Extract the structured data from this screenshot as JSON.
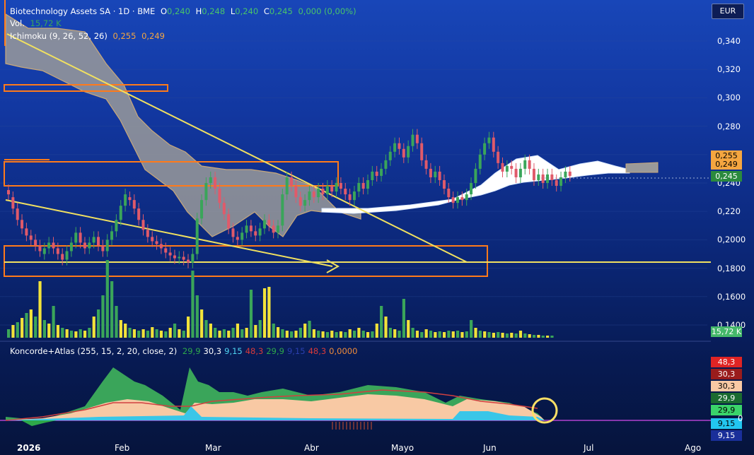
{
  "header": {
    "symbol": "Biotechnology Assets SA · 1D · BME",
    "o_label": "O",
    "o_value": "0,240",
    "h_label": "H",
    "h_value": "0,248",
    "l_label": "L",
    "l_value": "0,240",
    "c_label": "C",
    "c_value": "0,245",
    "change": "0,000 (0,00%)",
    "vol_label": "Vol.",
    "vol_value": "15,72 K",
    "ichimoku_label": "Ichimoku (9, 26, 52, 26)",
    "ichimoku_v1": "0,255",
    "ichimoku_v2": "0,249",
    "koncorde_label": "Koncorde+Atlas (255, 15, 2, 20, close, 2)",
    "koncorde_values": [
      {
        "v": "29,9",
        "color": "#2ea84a"
      },
      {
        "v": "30,3",
        "color": "#ffffff"
      },
      {
        "v": "9,15",
        "color": "#4fd3f0"
      },
      {
        "v": "48,3",
        "color": "#d83a3a"
      },
      {
        "v": "29,9",
        "color": "#2ea84a"
      },
      {
        "v": "9,15",
        "color": "#2a3fae"
      },
      {
        "v": "48,3",
        "color": "#d83a3a"
      },
      {
        "v": "0,0000",
        "color": "#f08c3a"
      }
    ]
  },
  "currency": "EUR",
  "y_axis": [
    "0,340",
    "0,320",
    "0,300",
    "0,280",
    "0,260",
    "0,240",
    "0,220",
    "0,2000",
    "0,1800",
    "0,1600",
    "0,1400"
  ],
  "price_badges": [
    {
      "label": "0,255",
      "bg": "#f5a640"
    },
    {
      "label": "0,249",
      "bg": "#f5a640"
    },
    {
      "label": "0,245",
      "bg": "#2b8a3e",
      "fg": "#ffffff"
    },
    {
      "label": "15,72 K",
      "bg": "#45b86a",
      "fg": "#ffffff"
    }
  ],
  "osc_badges": [
    {
      "label": "48,3",
      "bg": "#e02424",
      "fg": "#ffffff"
    },
    {
      "label": "30,3",
      "bg": "#9a1c1c",
      "fg": "#ffffff"
    },
    {
      "label": "30,3",
      "bg": "#f8c9a4",
      "fg": "#000000"
    },
    {
      "label": "29,9",
      "bg": "#1b6b30",
      "fg": "#ffffff"
    },
    {
      "label": "29,9",
      "bg": "#3ad36a",
      "fg": "#000000"
    },
    {
      "label": "9,15",
      "bg": "#22c6f0",
      "fg": "#000000"
    },
    {
      "label": "9,15",
      "bg": "#1a2f9a",
      "fg": "#ffffff"
    }
  ],
  "osc_zero": "0",
  "x_axis": [
    "2026",
    "Feb",
    "Mar",
    "Abr",
    "Mayo",
    "Jun",
    "Jul",
    "Ago"
  ],
  "colors": {
    "up": "#3aa55a",
    "down": "#e05a6a",
    "cloud": "#9a9a9a",
    "cloud_white": "#ffffff",
    "orange": "#ff7a1a",
    "yellow": "#f0e060",
    "vol_up": "#3aa55a",
    "vol_yellow": "#f2e23a"
  },
  "chart_data": {
    "type": "candlestick",
    "price_scale": [
      0.14,
      0.35
    ],
    "candles": [
      [
        0.235,
        0.232
      ],
      [
        0.23,
        0.222
      ],
      [
        0.222,
        0.214
      ],
      [
        0.214,
        0.208
      ],
      [
        0.208,
        0.203
      ],
      [
        0.203,
        0.2
      ],
      [
        0.2,
        0.196
      ],
      [
        0.196,
        0.192
      ],
      [
        0.19,
        0.194
      ],
      [
        0.194,
        0.198
      ],
      [
        0.198,
        0.194
      ],
      [
        0.194,
        0.19
      ],
      [
        0.19,
        0.186
      ],
      [
        0.186,
        0.192
      ],
      [
        0.192,
        0.198
      ],
      [
        0.198,
        0.205
      ],
      [
        0.205,
        0.198
      ],
      [
        0.198,
        0.194
      ],
      [
        0.194,
        0.198
      ],
      [
        0.198,
        0.202
      ],
      [
        0.202,
        0.196
      ],
      [
        0.196,
        0.192
      ],
      [
        0.192,
        0.2
      ],
      [
        0.2,
        0.206
      ],
      [
        0.206,
        0.214
      ],
      [
        0.214,
        0.224
      ],
      [
        0.224,
        0.232
      ],
      [
        0.23,
        0.228
      ],
      [
        0.228,
        0.222
      ],
      [
        0.222,
        0.214
      ],
      [
        0.214,
        0.207
      ],
      [
        0.207,
        0.202
      ],
      [
        0.202,
        0.199
      ],
      [
        0.199,
        0.197
      ],
      [
        0.197,
        0.194
      ],
      [
        0.194,
        0.191
      ],
      [
        0.191,
        0.189
      ],
      [
        0.189,
        0.187
      ],
      [
        0.187,
        0.188
      ],
      [
        0.188,
        0.186
      ],
      [
        0.186,
        0.184
      ],
      [
        0.184,
        0.19
      ],
      [
        0.19,
        0.215
      ],
      [
        0.215,
        0.228
      ],
      [
        0.228,
        0.24
      ],
      [
        0.24,
        0.244
      ],
      [
        0.244,
        0.236
      ],
      [
        0.236,
        0.226
      ],
      [
        0.226,
        0.218
      ],
      [
        0.218,
        0.208
      ],
      [
        0.208,
        0.202
      ],
      [
        0.202,
        0.2
      ],
      [
        0.2,
        0.205
      ],
      [
        0.205,
        0.21
      ],
      [
        0.21,
        0.206
      ],
      [
        0.206,
        0.203
      ],
      [
        0.203,
        0.208
      ],
      [
        0.208,
        0.214
      ],
      [
        0.214,
        0.21
      ],
      [
        0.21,
        0.205
      ],
      [
        0.205,
        0.21
      ],
      [
        0.21,
        0.232
      ],
      [
        0.232,
        0.244
      ],
      [
        0.244,
        0.238
      ],
      [
        0.238,
        0.23
      ],
      [
        0.23,
        0.224
      ],
      [
        0.224,
        0.228
      ],
      [
        0.228,
        0.234
      ],
      [
        0.234,
        0.23
      ],
      [
        0.23,
        0.236
      ],
      [
        0.236,
        0.232
      ],
      [
        0.232,
        0.238
      ],
      [
        0.238,
        0.234
      ],
      [
        0.234,
        0.24
      ],
      [
        0.24,
        0.236
      ],
      [
        0.236,
        0.232
      ],
      [
        0.232,
        0.228
      ],
      [
        0.228,
        0.234
      ],
      [
        0.234,
        0.24
      ],
      [
        0.24,
        0.236
      ],
      [
        0.236,
        0.242
      ],
      [
        0.242,
        0.248
      ],
      [
        0.248,
        0.245
      ],
      [
        0.245,
        0.25
      ],
      [
        0.25,
        0.256
      ],
      [
        0.256,
        0.262
      ],
      [
        0.262,
        0.268
      ],
      [
        0.268,
        0.264
      ],
      [
        0.264,
        0.258
      ],
      [
        0.258,
        0.266
      ],
      [
        0.266,
        0.274
      ],
      [
        0.274,
        0.268
      ],
      [
        0.268,
        0.256
      ],
      [
        0.256,
        0.25
      ],
      [
        0.25,
        0.244
      ],
      [
        0.244,
        0.248
      ],
      [
        0.248,
        0.242
      ],
      [
        0.242,
        0.236
      ],
      [
        0.236,
        0.23
      ],
      [
        0.23,
        0.226
      ],
      [
        0.226,
        0.23
      ],
      [
        0.23,
        0.228
      ],
      [
        0.228,
        0.232
      ],
      [
        0.232,
        0.24
      ],
      [
        0.24,
        0.25
      ],
      [
        0.25,
        0.26
      ],
      [
        0.26,
        0.268
      ],
      [
        0.268,
        0.272
      ],
      [
        0.272,
        0.262
      ],
      [
        0.262,
        0.254
      ],
      [
        0.254,
        0.248
      ],
      [
        0.248,
        0.252
      ],
      [
        0.252,
        0.25
      ],
      [
        0.25,
        0.244
      ],
      [
        0.244,
        0.25
      ],
      [
        0.25,
        0.256
      ],
      [
        0.256,
        0.25
      ],
      [
        0.25,
        0.242
      ],
      [
        0.242,
        0.246
      ],
      [
        0.246,
        0.24
      ],
      [
        0.24,
        0.246
      ],
      [
        0.246,
        0.242
      ],
      [
        0.242,
        0.238
      ],
      [
        0.238,
        0.244
      ],
      [
        0.244,
        0.248
      ],
      [
        0.248,
        0.245
      ]
    ],
    "volume": [
      [
        12,
        "u"
      ],
      [
        18,
        "y"
      ],
      [
        22,
        "u"
      ],
      [
        28,
        "y"
      ],
      [
        35,
        "u"
      ],
      [
        40,
        "y"
      ],
      [
        30,
        "u"
      ],
      [
        80,
        "y"
      ],
      [
        25,
        "u"
      ],
      [
        20,
        "y"
      ],
      [
        45,
        "u"
      ],
      [
        18,
        "y"
      ],
      [
        14,
        "u"
      ],
      [
        12,
        "y"
      ],
      [
        10,
        "u"
      ],
      [
        9,
        "y"
      ],
      [
        12,
        "u"
      ],
      [
        10,
        "y"
      ],
      [
        14,
        "u"
      ],
      [
        30,
        "y"
      ],
      [
        40,
        "u"
      ],
      [
        60,
        "u"
      ],
      [
        110,
        "u"
      ],
      [
        80,
        "u"
      ],
      [
        45,
        "u"
      ],
      [
        25,
        "y"
      ],
      [
        20,
        "y"
      ],
      [
        14,
        "u"
      ],
      [
        12,
        "y"
      ],
      [
        10,
        "u"
      ],
      [
        12,
        "y"
      ],
      [
        10,
        "u"
      ],
      [
        15,
        "y"
      ],
      [
        12,
        "u"
      ],
      [
        10,
        "y"
      ],
      [
        9,
        "u"
      ],
      [
        14,
        "y"
      ],
      [
        20,
        "u"
      ],
      [
        12,
        "y"
      ],
      [
        10,
        "u"
      ],
      [
        30,
        "y"
      ],
      [
        95,
        "u"
      ],
      [
        60,
        "u"
      ],
      [
        40,
        "y"
      ],
      [
        25,
        "u"
      ],
      [
        20,
        "y"
      ],
      [
        14,
        "u"
      ],
      [
        10,
        "y"
      ],
      [
        12,
        "u"
      ],
      [
        10,
        "y"
      ],
      [
        14,
        "u"
      ],
      [
        20,
        "y"
      ],
      [
        12,
        "u"
      ],
      [
        14,
        "y"
      ],
      [
        68,
        "u"
      ],
      [
        18,
        "y"
      ],
      [
        25,
        "u"
      ],
      [
        70,
        "y"
      ],
      [
        72,
        "y"
      ],
      [
        20,
        "u"
      ],
      [
        15,
        "y"
      ],
      [
        12,
        "u"
      ],
      [
        10,
        "y"
      ],
      [
        9,
        "u"
      ],
      [
        10,
        "y"
      ],
      [
        14,
        "u"
      ],
      [
        20,
        "y"
      ],
      [
        24,
        "u"
      ],
      [
        12,
        "y"
      ],
      [
        10,
        "u"
      ],
      [
        9,
        "y"
      ],
      [
        8,
        "u"
      ],
      [
        10,
        "y"
      ],
      [
        8,
        "u"
      ],
      [
        9,
        "y"
      ],
      [
        8,
        "u"
      ],
      [
        12,
        "y"
      ],
      [
        10,
        "u"
      ],
      [
        14,
        "y"
      ],
      [
        10,
        "u"
      ],
      [
        8,
        "y"
      ],
      [
        9,
        "u"
      ],
      [
        20,
        "y"
      ],
      [
        45,
        "u"
      ],
      [
        30,
        "y"
      ],
      [
        14,
        "u"
      ],
      [
        12,
        "y"
      ],
      [
        10,
        "u"
      ],
      [
        55,
        "u"
      ],
      [
        25,
        "y"
      ],
      [
        14,
        "u"
      ],
      [
        10,
        "y"
      ],
      [
        8,
        "u"
      ],
      [
        12,
        "y"
      ],
      [
        10,
        "u"
      ],
      [
        8,
        "y"
      ],
      [
        9,
        "u"
      ],
      [
        8,
        "y"
      ],
      [
        10,
        "u"
      ],
      [
        9,
        "y"
      ],
      [
        10,
        "u"
      ],
      [
        8,
        "y"
      ],
      [
        9,
        "u"
      ],
      [
        25,
        "u"
      ],
      [
        14,
        "y"
      ],
      [
        10,
        "u"
      ],
      [
        9,
        "y"
      ],
      [
        8,
        "u"
      ],
      [
        7,
        "y"
      ],
      [
        8,
        "u"
      ],
      [
        7,
        "y"
      ],
      [
        6,
        "u"
      ],
      [
        7,
        "y"
      ],
      [
        6,
        "u"
      ],
      [
        10,
        "y"
      ],
      [
        6,
        "u"
      ],
      [
        5,
        "y"
      ],
      [
        4,
        "u"
      ],
      [
        4,
        "y"
      ],
      [
        3,
        "u"
      ],
      [
        3,
        "y"
      ],
      [
        3,
        "u"
      ]
    ]
  }
}
